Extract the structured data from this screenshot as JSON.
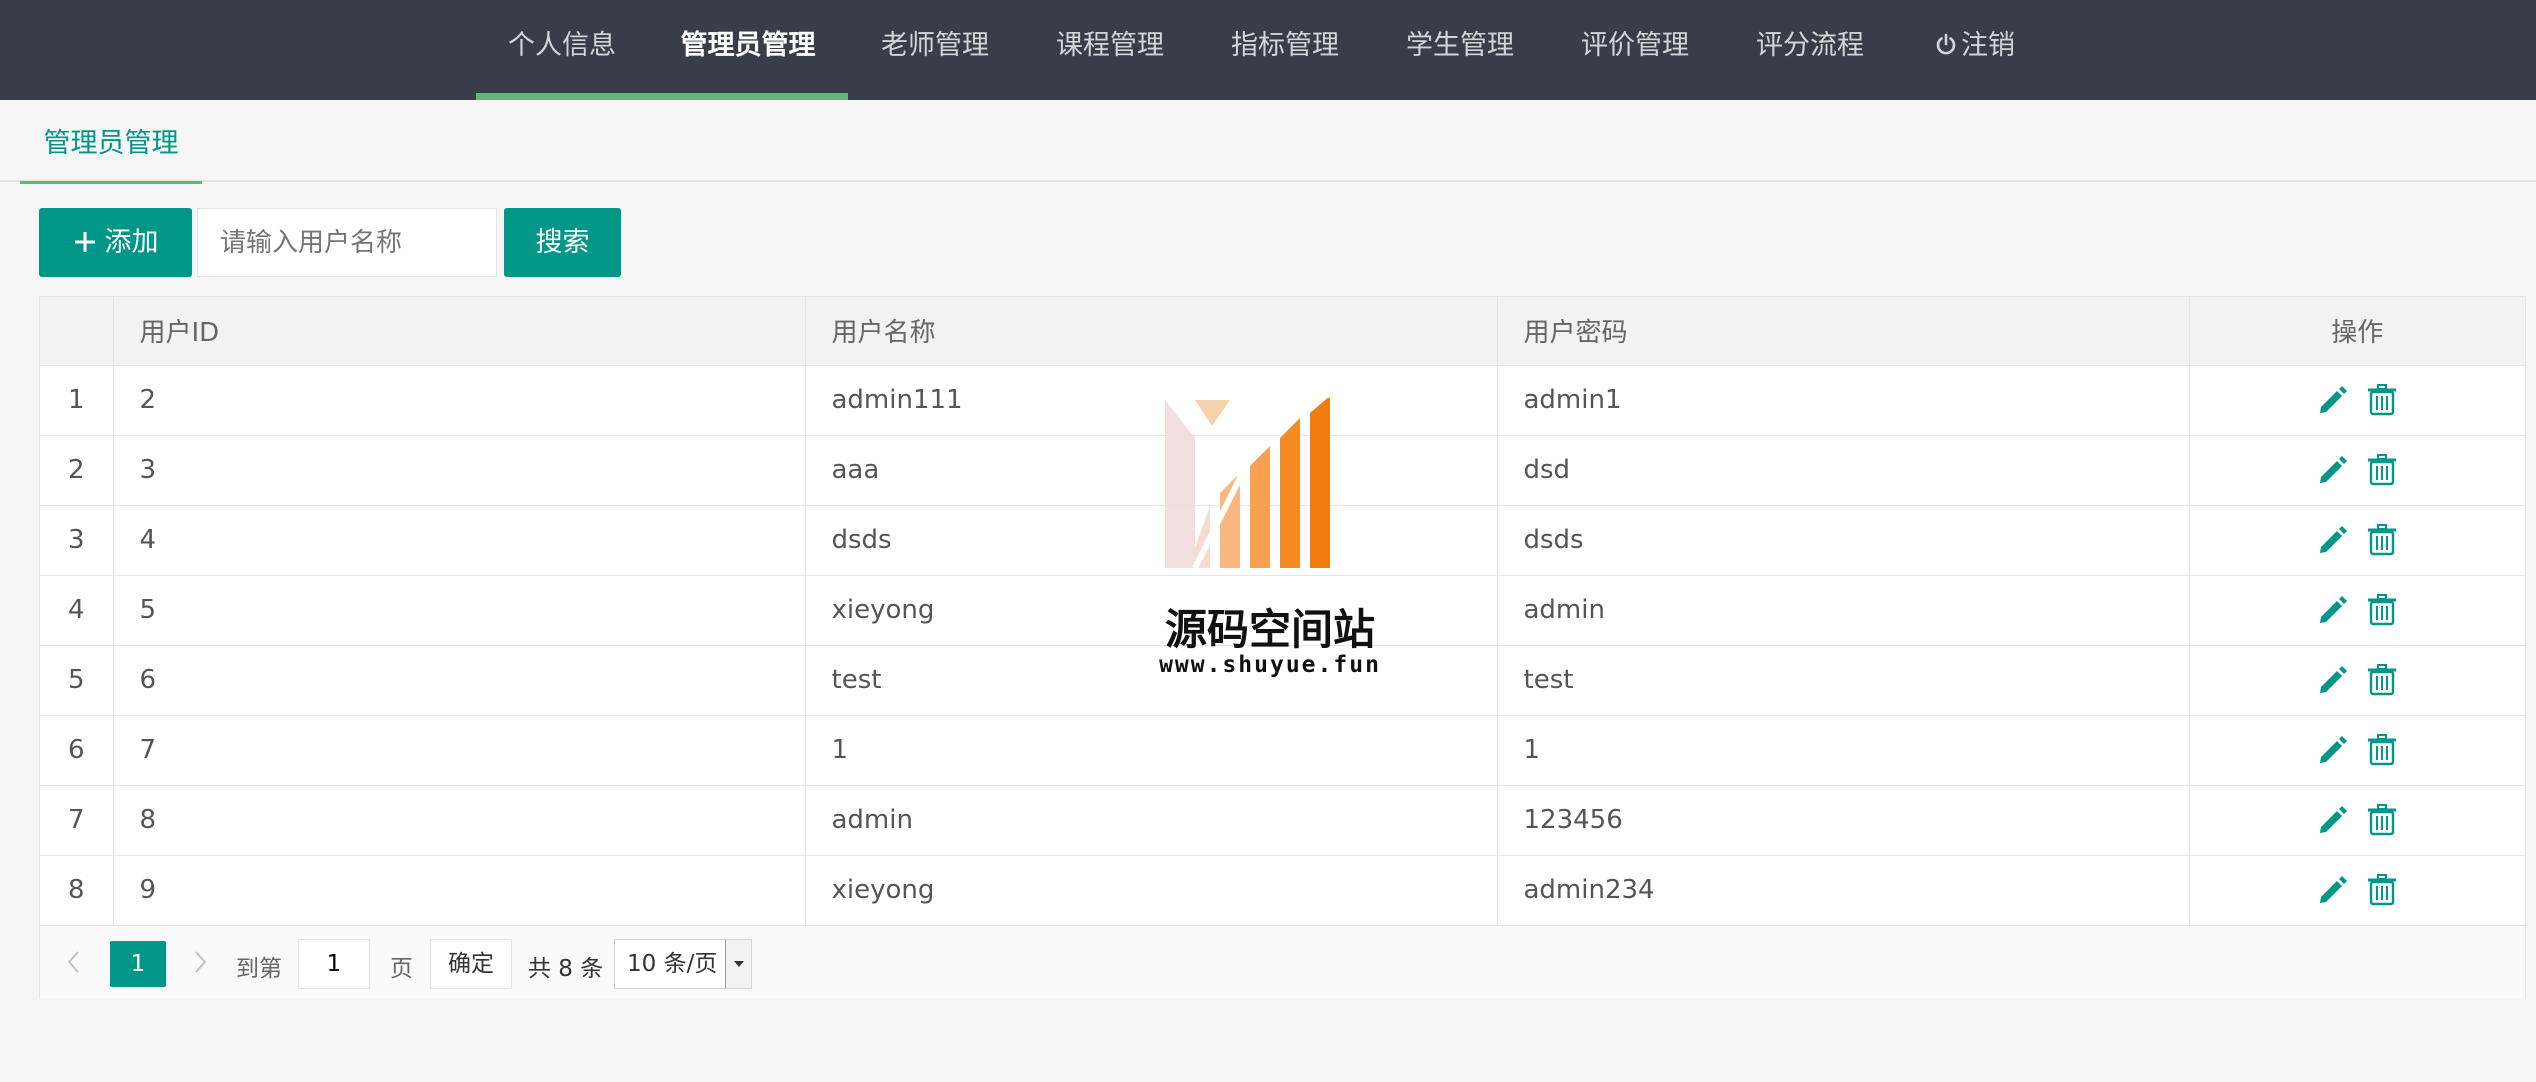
{
  "nav": {
    "items": [
      {
        "label": "个人信息"
      },
      {
        "label": "管理员管理"
      },
      {
        "label": "老师管理"
      },
      {
        "label": "课程管理"
      },
      {
        "label": "指标管理"
      },
      {
        "label": "学生管理"
      },
      {
        "label": "评价管理"
      },
      {
        "label": "评分流程"
      },
      {
        "label": "注销",
        "icon": "power-icon"
      }
    ],
    "active_index": 1
  },
  "tab": {
    "label": "管理员管理"
  },
  "toolbar": {
    "add_label": "添加",
    "search_placeholder": "请输入用户名称",
    "search_value": "",
    "search_label": "搜索"
  },
  "table": {
    "headers": [
      "",
      "用户ID",
      "用户名称",
      "用户密码",
      "操作"
    ],
    "rows": [
      {
        "num": "1",
        "id": "2",
        "name": "admin111",
        "password": "admin1"
      },
      {
        "num": "2",
        "id": "3",
        "name": "aaa",
        "password": "dsd"
      },
      {
        "num": "3",
        "id": "4",
        "name": "dsds",
        "password": "dsds"
      },
      {
        "num": "4",
        "id": "5",
        "name": "xieyong",
        "password": "admin"
      },
      {
        "num": "5",
        "id": "6",
        "name": "test",
        "password": "test"
      },
      {
        "num": "6",
        "id": "7",
        "name": "1",
        "password": "1"
      },
      {
        "num": "7",
        "id": "8",
        "name": "admin",
        "password": "123456"
      },
      {
        "num": "8",
        "id": "9",
        "name": "xieyong",
        "password": "admin234"
      }
    ],
    "row_actions": [
      "edit-icon",
      "delete-icon"
    ]
  },
  "pagination": {
    "current_page": "1",
    "goto_label": "到第",
    "goto_value": "1",
    "page_unit": "页",
    "confirm_label": "确定",
    "total_label": "共 8 条",
    "page_size_label": "10 条/页"
  },
  "watermark": {
    "title": "源码空间站",
    "url": "www.shuyue.fun"
  },
  "colors": {
    "nav_bg": "#393d49",
    "accent_teal": "#009688",
    "active_underline": "#5fb878",
    "page_bg": "#f6f6f6"
  }
}
